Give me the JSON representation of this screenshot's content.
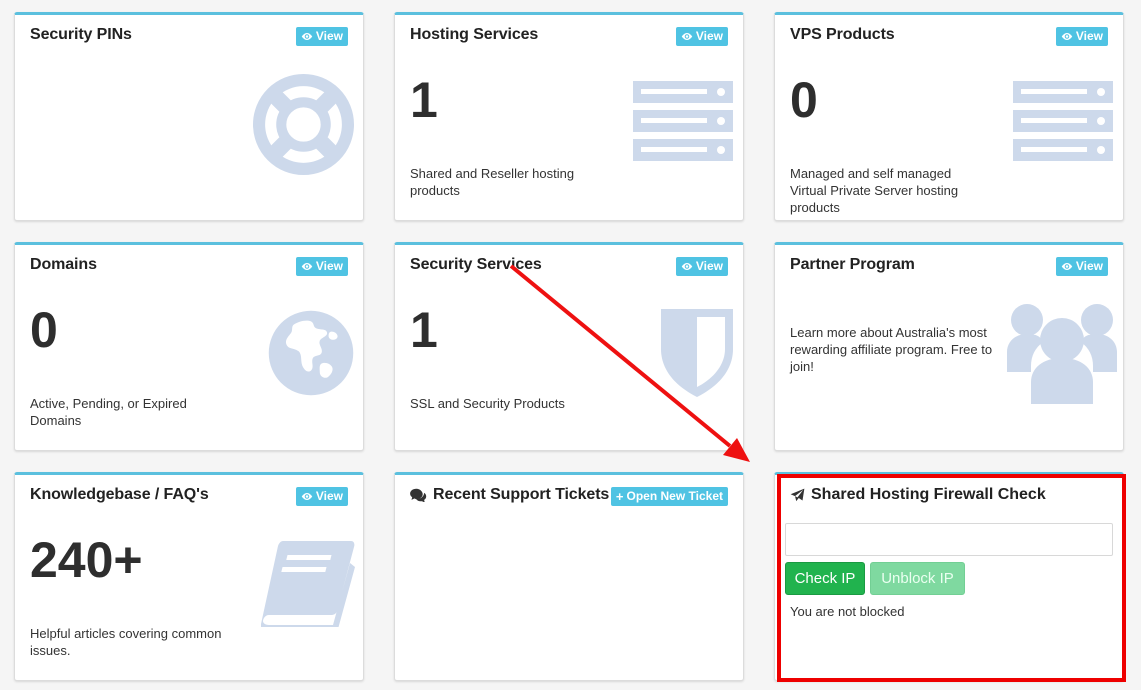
{
  "colors": {
    "accent": "#5bc0de",
    "view_button": "#4fc3e3",
    "icon_fill": "#cdd9eb",
    "check_button": "#21b34e",
    "unblock_button": "#7fd9a0",
    "highlight": "#ee0000"
  },
  "view_label": "View",
  "panels": {
    "security_pins": {
      "title": "Security PINs",
      "icon": "life-ring-icon"
    },
    "hosting": {
      "title": "Hosting Services",
      "count": "1",
      "desc": "Shared and Reseller hosting products",
      "icon": "server-icon"
    },
    "vps": {
      "title": "VPS Products",
      "count": "0",
      "desc": "Managed and self managed Virtual Private Server hosting products",
      "icon": "server-icon"
    },
    "domains": {
      "title": "Domains",
      "count": "0",
      "desc": "Active, Pending, or Expired Domains",
      "icon": "globe-icon"
    },
    "security_services": {
      "title": "Security Services",
      "count": "1",
      "desc": "SSL and Security Products",
      "icon": "shield-icon"
    },
    "partner": {
      "title": "Partner Program",
      "desc": "Learn more about Australia's most rewarding affiliate program. Free to join!",
      "icon": "users-icon"
    },
    "knowledgebase": {
      "title": "Knowledgebase / FAQ's",
      "count": "240+",
      "desc": "Helpful articles covering common issues.",
      "icon": "book-icon"
    },
    "tickets": {
      "title": "Recent Support Tickets",
      "button_label": "Open New Ticket",
      "icon": "comments-icon"
    },
    "firewall": {
      "title": "Shared Hosting Firewall Check",
      "icon": "paper-plane-icon",
      "input_value": "",
      "check_label": "Check IP",
      "unblock_label": "Unblock IP",
      "status": "You are not blocked"
    }
  }
}
